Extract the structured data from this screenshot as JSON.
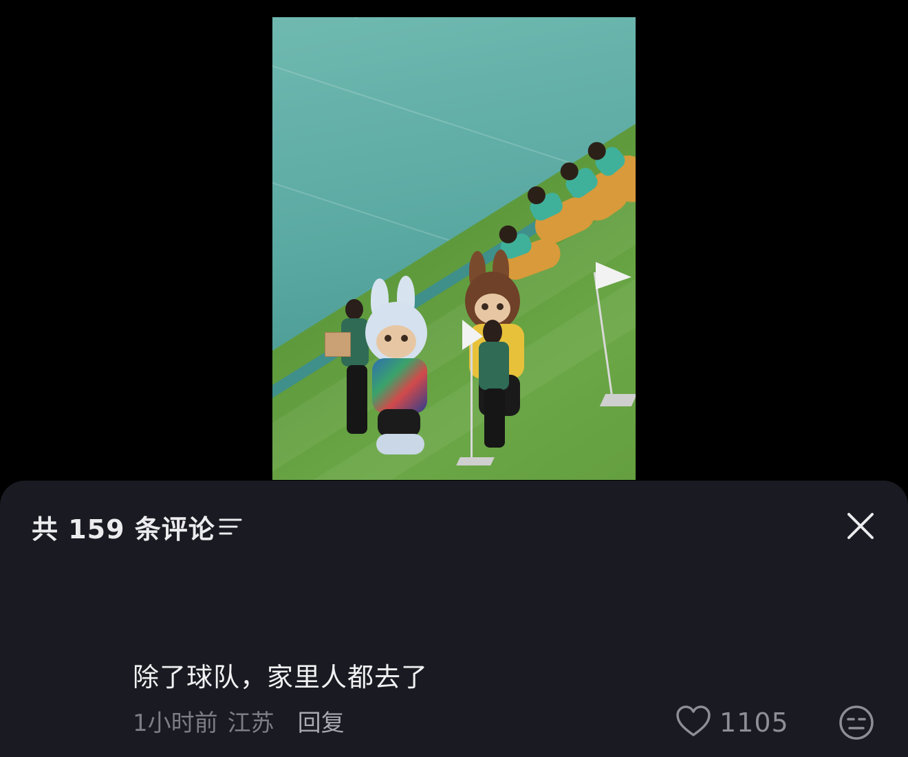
{
  "comments_panel": {
    "title": "共 159 条评论",
    "sort_icon": "sort-filter-icon",
    "close_icon": "close-icon"
  },
  "comment": {
    "text": "除了球队，家里人都去了",
    "time": "1小时前",
    "location": "江苏",
    "reply_label": "回复",
    "like_count": "1105",
    "like_icon": "heart-outline-icon",
    "dislike_icon": "meh-face-icon"
  },
  "colors": {
    "sheet_background": "#1a1a22",
    "primary_text": "#f1f1f3",
    "secondary_text": "#7d7d85"
  }
}
